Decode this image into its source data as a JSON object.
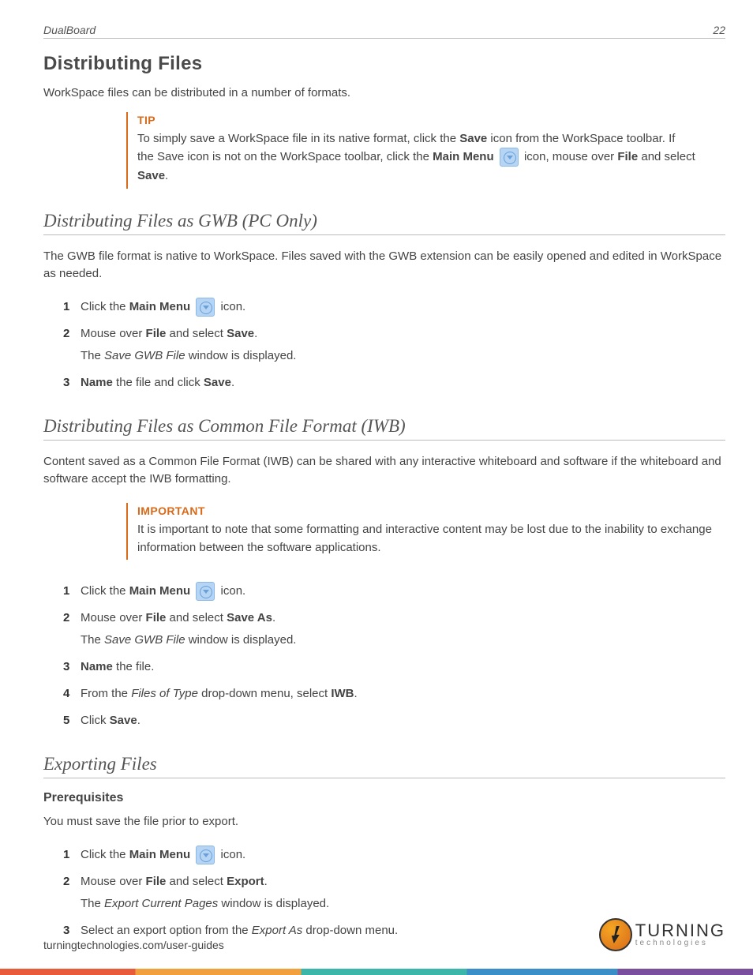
{
  "header": {
    "doc_title": "DualBoard",
    "page_number": "22"
  },
  "main_heading": "Distributing Files",
  "intro": "WorkSpace files can be distributed in a number of formats.",
  "tip": {
    "label": "TIP",
    "line1_pre": "To simply save a WorkSpace file in its native format, click the ",
    "line1_b1": "Save",
    "line1_post": " icon from the WorkSpace toolbar. If",
    "line2_pre": "the Save icon is not on the WorkSpace toolbar, click the ",
    "line2_b1": "Main Menu",
    "line2_mid": " icon, mouse over ",
    "line2_b2": "File",
    "line2_post": " and select ",
    "line2_b3": "Save",
    "line2_end": "."
  },
  "sec1": {
    "heading": "Distributing Files as GWB (PC Only)",
    "body": "The GWB file format is native to WorkSpace. Files saved with the GWB extension can be easily opened and edited in WorkSpace as needed.",
    "steps": {
      "s1_pre": "Click the ",
      "s1_b1": "Main Menu",
      "s1_post": " icon.",
      "s2_pre": "Mouse over ",
      "s2_b1": "File",
      "s2_mid": " and select ",
      "s2_b2": "Save",
      "s2_end": ".",
      "s2_sub_pre": "The ",
      "s2_sub_i": "Save GWB File",
      "s2_sub_post": " window is displayed.",
      "s3_b1": "Name",
      "s3_mid": " the file and click ",
      "s3_b2": "Save",
      "s3_end": "."
    }
  },
  "sec2": {
    "heading": "Distributing Files as Common File Format (IWB)",
    "body": "Content saved as a Common File Format (IWB) can be shared with any interactive whiteboard and software if the whiteboard and software accept the IWB formatting.",
    "important": {
      "label": "IMPORTANT",
      "body": "It is important to note that some formatting and interactive content may be lost due to the inability to exchange information between the software applications."
    },
    "steps": {
      "s1_pre": "Click the ",
      "s1_b1": "Main Menu",
      "s1_post": " icon.",
      "s2_pre": "Mouse over ",
      "s2_b1": "File",
      "s2_mid": " and select ",
      "s2_b2": "Save As",
      "s2_end": ".",
      "s2_sub_pre": "The ",
      "s2_sub_i": "Save GWB File",
      "s2_sub_post": " window is displayed.",
      "s3_b1": "Name",
      "s3_post": " the file.",
      "s4_pre": "From the ",
      "s4_i": "Files of Type",
      "s4_mid": " drop-down menu, select ",
      "s4_b1": "IWB",
      "s4_end": ".",
      "s5_pre": "Click ",
      "s5_b1": "Save",
      "s5_end": "."
    }
  },
  "sec3": {
    "heading": "Exporting Files",
    "sub_heading": "Prerequisites",
    "body": "You must save the file prior to export.",
    "steps": {
      "s1_pre": "Click the ",
      "s1_b1": "Main Menu",
      "s1_post": " icon.",
      "s2_pre": "Mouse over ",
      "s2_b1": "File",
      "s2_mid": " and select ",
      "s2_b2": "Export",
      "s2_end": ".",
      "s2_sub_pre": "The ",
      "s2_sub_i": "Export Current Pages",
      "s2_sub_post": " window is displayed.",
      "s3_pre": "Select an export option from the ",
      "s3_i": "Export As",
      "s3_post": " drop-down menu."
    }
  },
  "footer": {
    "url": "turningtechnologies.com/user-guides",
    "logo_big": "TURNING",
    "logo_small": "technologies"
  }
}
